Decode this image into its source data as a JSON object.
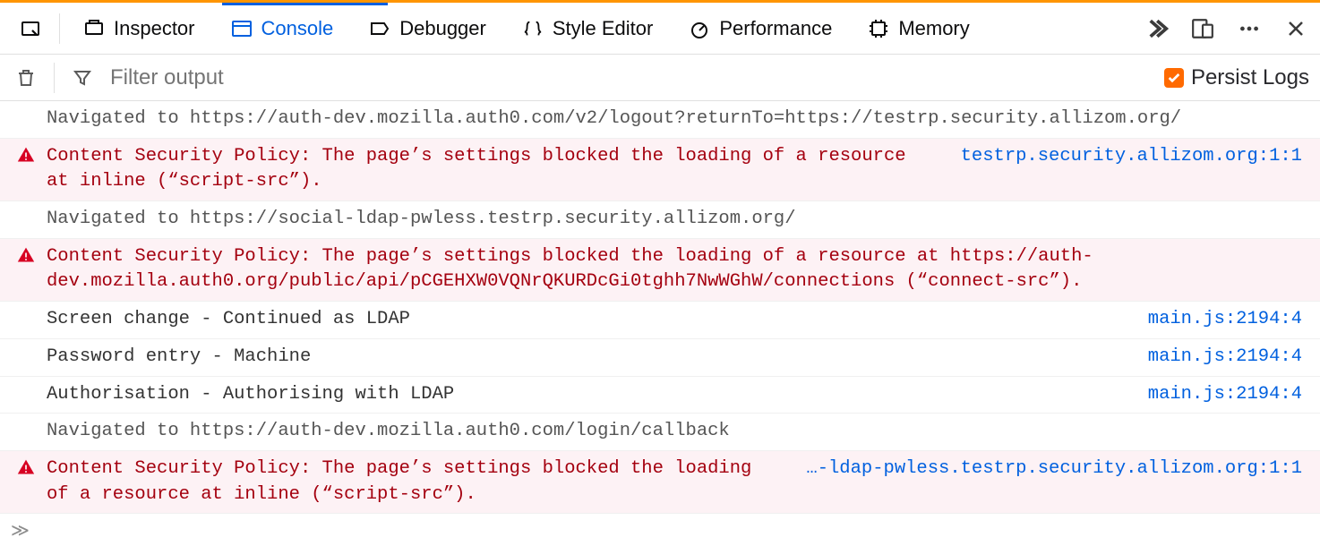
{
  "tabs": {
    "inspector": "Inspector",
    "console": "Console",
    "debugger": "Debugger",
    "style_editor": "Style Editor",
    "performance": "Performance",
    "memory": "Memory"
  },
  "filter": {
    "placeholder": "Filter output",
    "persist_label": "Persist Logs",
    "persist_checked": true
  },
  "logs": [
    {
      "type": "nav",
      "msg": "Navigated to https://auth-dev.mozilla.auth0.com/v2/logout?returnTo=https://testrp.security.allizom.org/",
      "src": ""
    },
    {
      "type": "err",
      "msg": "Content Security Policy: The page’s settings blocked the loading of a resource at inline (“script-src”).",
      "src": "testrp.security.allizom.org:1:1"
    },
    {
      "type": "nav",
      "msg": "Navigated to https://social-ldap-pwless.testrp.security.allizom.org/",
      "src": ""
    },
    {
      "type": "err",
      "msg": "Content Security Policy: The page’s settings blocked the loading of a resource at https://auth-dev.mozilla.auth0.org/public/api/pCGEHXW0VQNrQKURDcGi0tghh7NwWGhW/connections (“connect-src”).",
      "src": ""
    },
    {
      "type": "log2",
      "msg": "Screen change - Continued as LDAP",
      "src": "main.js:2194:4"
    },
    {
      "type": "log2",
      "msg": "Password entry - Machine",
      "src": "main.js:2194:4"
    },
    {
      "type": "log2",
      "msg": "Authorisation - Authorising with LDAP",
      "src": "main.js:2194:4"
    },
    {
      "type": "nav",
      "msg": "Navigated to https://auth-dev.mozilla.auth0.com/login/callback",
      "src": ""
    },
    {
      "type": "err",
      "msg": "Content Security Policy: The page’s settings blocked the loading of a resource at inline (“script-src”).",
      "src": "…-ldap-pwless.testrp.security.allizom.org:1:1"
    }
  ],
  "prompt": "≫"
}
